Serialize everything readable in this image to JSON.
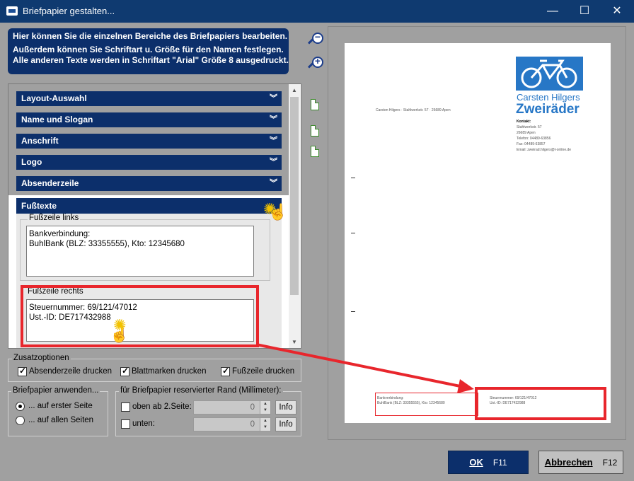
{
  "window": {
    "title": "Briefpapier gestalten...",
    "minimize": "—",
    "maximize": "☐",
    "close": "✕"
  },
  "info": {
    "line1": "Hier können Sie die einzelnen Bereiche des Briefpapiers bearbeiten.",
    "line2": "Außerdem können Sie Schriftart u. Größe für den Namen festlegen.",
    "line3": "Alle anderen Texte werden in Schriftart \"Arial\" Größe 8 ausgedruckt."
  },
  "sections": [
    {
      "label": "Layout-Auswahl"
    },
    {
      "label": "Name und Slogan"
    },
    {
      "label": "Anschrift"
    },
    {
      "label": "Logo"
    },
    {
      "label": "Absenderzeile"
    }
  ],
  "chevron": "»",
  "fusstexte": {
    "label": "Fußtexte",
    "links_label": "Fußzeile links",
    "links_line1": "Bankverbindung:",
    "links_line2": "BuhlBank (BLZ: 33355555), Kto: 12345680",
    "rechts_label": "Fußzeile rechts",
    "rechts_line1": "Steuernummer: 69/121/47012",
    "rechts_line2": "Ust.-ID: DE717432988"
  },
  "zusatz": {
    "label": "Zusatzoptionen",
    "absenderzeile": "Absenderzeile drucken",
    "blattmarken": "Blattmarken drucken",
    "fusszeile": "Fußzeile drucken"
  },
  "anwenden": {
    "label": "Briefpapier anwenden...",
    "erste": "... auf erster Seite",
    "allen": "... auf allen Seiten"
  },
  "rand": {
    "label": "für Briefpapier reservierter Rand (Millimeter):",
    "oben": "oben ab 2.Seite:",
    "unten": "unten:",
    "oben_value": "0",
    "unten_value": "0",
    "info": "Info"
  },
  "preview": {
    "company1": "Carsten Hilgers",
    "company2": "Zweiräder",
    "sender_line": "Carsten Hilgers · Stahlwerkstr. 57 · 26689 Apen",
    "kontakt": "Kontakt:",
    "addr1": "Stahlwerkstr. 57",
    "addr2": "26689 Apen",
    "tel": "Telefon: 04489-63856",
    "fax": "Fax: 04489-63857",
    "email": "Email: zweirad.hilgers@t-online.de",
    "foot_left1": "Bankverbindung:",
    "foot_left2": "BuhlBank (BLZ: 33355555), Kto: 12345680",
    "foot_right1": "Steuernummer: 69/121/47012",
    "foot_right2": "Ust.-ID: DE717432988"
  },
  "buttons": {
    "ok": "OK",
    "ok_key": "F11",
    "cancel": "Abbrechen",
    "cancel_key": "F12"
  },
  "colors": {
    "titlebar": "#0f3a70",
    "header": "#0c2f6b",
    "highlight": "#e8262c",
    "logo": "#2777c6"
  }
}
